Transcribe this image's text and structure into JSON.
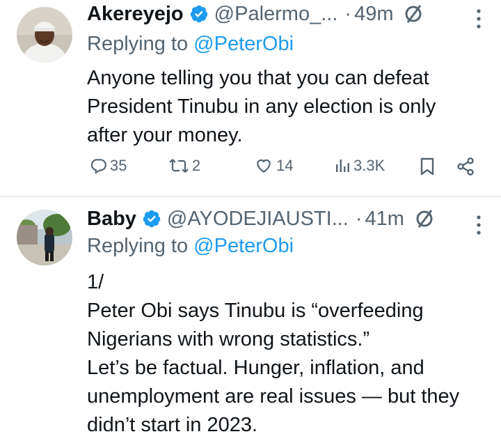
{
  "tweets": [
    {
      "author": {
        "name": "Akereyejo",
        "handle": "@Palermo_...",
        "time": "49m",
        "avatar": "man-in-white-cap-avatar"
      },
      "replying_label": "Replying to",
      "replying_to": "@PeterObi",
      "lines": [
        "Anyone telling you that you can defeat",
        "President Tinubu in any election is only",
        "after your money."
      ],
      "actions": {
        "replies": "35",
        "reposts": "2",
        "likes": "14",
        "views": "3.3K"
      }
    },
    {
      "author": {
        "name": "Baby",
        "handle": "@AYODEJIAUSTI...",
        "time": "41m",
        "avatar": "person-in-park-avatar"
      },
      "replying_label": "Replying to",
      "replying_to": "@PeterObi",
      "lines": [
        "1/",
        "Peter Obi says Tinubu is “overfeeding",
        "Nigerians with wrong statistics.”",
        "Let’s be factual. Hunger, inflation, and",
        "unemployment are real issues — but they",
        "didn’t start in 2023."
      ]
    }
  ],
  "colors": {
    "verified": "#1d9bf0",
    "link": "#1d9bf0",
    "secondary": "#536471",
    "text": "#0f1419"
  },
  "icons": [
    "verified-badge-icon",
    "grok-icon",
    "more-icon",
    "reply-icon",
    "repost-icon",
    "like-icon",
    "views-icon",
    "bookmark-icon",
    "share-icon"
  ]
}
